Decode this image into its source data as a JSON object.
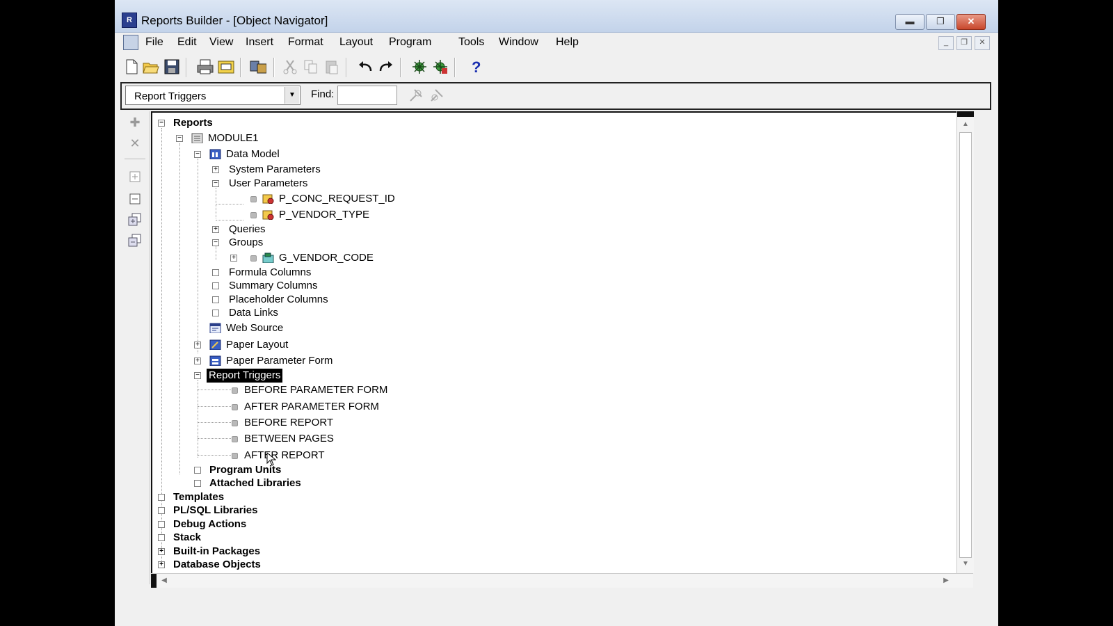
{
  "window": {
    "title": "Reports Builder - [Object Navigator]"
  },
  "menu": [
    "File",
    "Edit",
    "View",
    "Insert",
    "Format",
    "Layout",
    "Program",
    "Tools",
    "Window",
    "Help"
  ],
  "toolbar": {
    "icons": [
      "new-file-icon",
      "open-folder-icon",
      "save-icon",
      "print-icon",
      "print-setup-icon",
      "compile-icon",
      "cut-icon",
      "copy-icon",
      "paste-icon",
      "undo-icon",
      "redo-icon",
      "run-icon",
      "debug-icon",
      "help-icon"
    ]
  },
  "findbar": {
    "type_select_value": "Report Triggers",
    "find_label": "Find:",
    "find_value": ""
  },
  "tree": {
    "reports": "Reports",
    "module": "MODULE1",
    "data_model": "Data Model",
    "system_parameters": "System Parameters",
    "user_parameters": "User Parameters",
    "param1": "P_CONC_REQUEST_ID",
    "param2": "P_VENDOR_TYPE",
    "queries": "Queries",
    "groups": "Groups",
    "group1": "G_VENDOR_CODE",
    "formula_columns": "Formula Columns",
    "summary_columns": "Summary Columns",
    "placeholder_columns": "Placeholder Columns",
    "data_links": "Data Links",
    "web_source": "Web Source",
    "paper_layout": "Paper Layout",
    "paper_parameter_form": "Paper Parameter Form",
    "report_triggers": "Report Triggers",
    "trigger1": "BEFORE PARAMETER FORM",
    "trigger2": "AFTER PARAMETER FORM",
    "trigger3": "BEFORE REPORT",
    "trigger4": "BETWEEN PAGES",
    "trigger5": "AFTER REPORT",
    "program_units": "Program Units",
    "attached_libraries": "Attached Libraries",
    "templates": "Templates",
    "plsql_libraries": "PL/SQL Libraries",
    "debug_actions": "Debug Actions",
    "stack": "Stack",
    "builtin_packages": "Built-in Packages",
    "database_objects": "Database Objects"
  }
}
